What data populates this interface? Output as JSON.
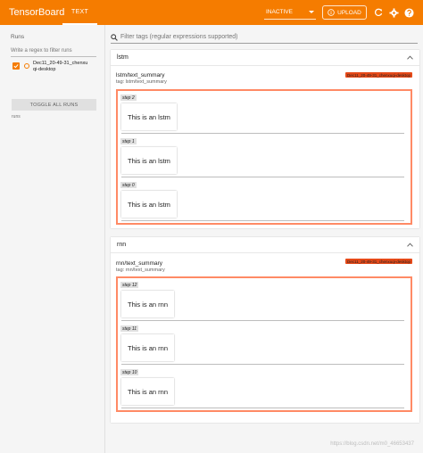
{
  "app": {
    "title": "TensorBoard",
    "tab": "TEXT",
    "status_select": "INACTIVE",
    "upload_label": "UPLOAD"
  },
  "colors": {
    "brand": "#f57c00",
    "run": "#e64a19",
    "frame": "#ff8a65"
  },
  "icons": [
    "chevron-down-icon",
    "info-icon",
    "refresh-icon",
    "gear-icon",
    "help-icon",
    "search-icon",
    "chevron-up-icon",
    "check-icon"
  ],
  "sidebar": {
    "title": "Runs",
    "regex_placeholder": "Write a regex to filter runs",
    "run_name": "Dec11_20-49-31_chenxuqi-desktop",
    "toggle_label": "TOGGLE ALL RUNS",
    "runs_label": "runs"
  },
  "search": {
    "placeholder": "Filter tags (regular expressions supported)"
  },
  "sections": [
    {
      "name": "lstm",
      "summary_title": "lstm/text_summary",
      "summary_tag": "tag: lstm/text_summary",
      "run_badge": "Dec11_20-49-31_chenxuqi-desktop",
      "steps": [
        {
          "label": "step 2",
          "text": "This is an lstm"
        },
        {
          "label": "step 1",
          "text": "This is an lstm"
        },
        {
          "label": "step 0",
          "text": "This is an lstm"
        }
      ]
    },
    {
      "name": "rnn",
      "summary_title": "rnn/text_summary",
      "summary_tag": "tag: rnn/text_summary",
      "run_badge": "Dec11_20-49-31_chenxuqi-desktop",
      "steps": [
        {
          "label": "step 12",
          "text": "This is an rnn"
        },
        {
          "label": "step 11",
          "text": "This is an rnn"
        },
        {
          "label": "step 10",
          "text": "This is an rnn"
        }
      ]
    }
  ],
  "watermark": "https://blog.csdn.net/m0_46653437"
}
